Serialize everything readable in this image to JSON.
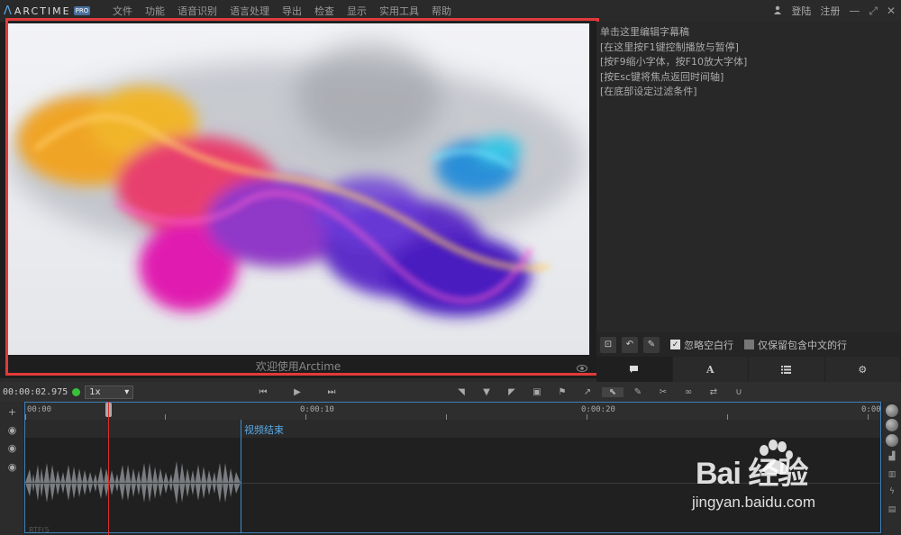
{
  "app": {
    "logo_text": "ARCTIME",
    "pro_badge": "PRO",
    "menu": [
      "文件",
      "功能",
      "语音识别",
      "语言处理",
      "导出",
      "检查",
      "显示",
      "实用工具",
      "帮助"
    ],
    "login": "登陆",
    "register": "注册"
  },
  "video": {
    "caption": "欢迎使用Arctime"
  },
  "subtitle_panel": {
    "lines": [
      "单击这里编辑字幕稿",
      "[在这里按F1键控制播放与暂停]",
      "[按F9缩小字体，按F10放大字体]",
      "[按Esc键将焦点返回时间轴]",
      "[在底部设定过滤条件]"
    ],
    "ignore_blank_label": "忽略空白行",
    "ignore_blank_checked": true,
    "keep_chinese_label": "仅保留包含中文的行",
    "keep_chinese_checked": false,
    "tab_text_glyph": "A"
  },
  "controls": {
    "timecode": "00:00:02.975",
    "speed": "1x"
  },
  "timeline": {
    "ticks": [
      "00:00",
      "0:00:10",
      "0:00:20",
      "0:00"
    ],
    "end_label": "视频结束",
    "track_name": "RTF(5"
  },
  "watermark": {
    "brand": "Bai 经验",
    "url": "jingyan.baidu.com"
  },
  "colors": {
    "accent_blue": "#3d7fb8",
    "playhead_red": "#d83030",
    "status_green": "#39c03a",
    "highlight_red": "#e23a3a"
  }
}
